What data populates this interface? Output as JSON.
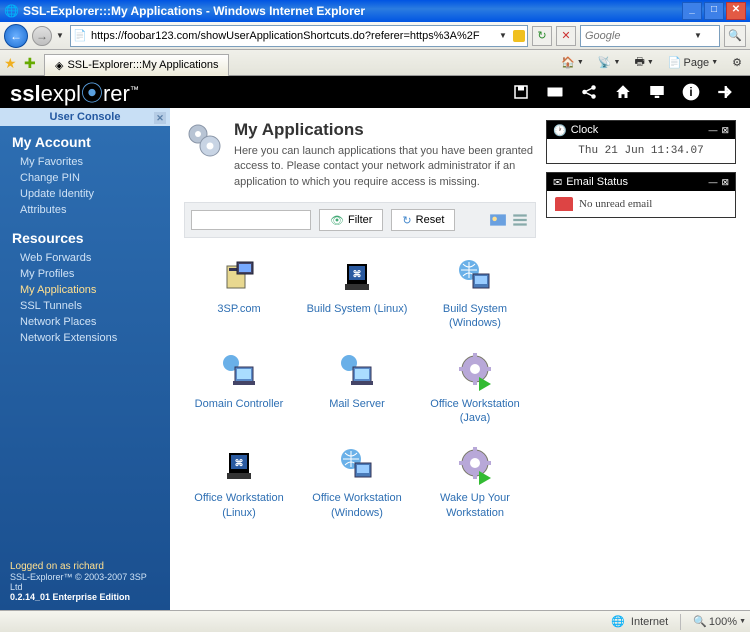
{
  "window": {
    "title": "SSL-Explorer:::My Applications - Windows Internet Explorer"
  },
  "browser": {
    "url": "https://foobar123.com/showUserApplicationShortcuts.do?referer=https%3A%2F",
    "search_placeholder": "Google",
    "tab_title": "SSL-Explorer:::My Applications",
    "cmd": {
      "page": "Page"
    },
    "status": {
      "zone": "Internet",
      "zoom": "100%"
    }
  },
  "logo": {
    "pre": "ssl",
    "mid": "expl",
    "o": "o",
    "post": "rer"
  },
  "sidebar": {
    "console_label": "User Console",
    "account_heading": "My Account",
    "account_links": [
      "My Favorites",
      "Change PIN",
      "Update Identity",
      "Attributes"
    ],
    "resources_heading": "Resources",
    "resource_links": [
      "Web Forwards",
      "My Profiles",
      "My Applications",
      "SSL Tunnels",
      "Network Places",
      "Network Extensions"
    ],
    "active_resource_index": 2,
    "logged_on": "Logged on as richard",
    "copyright": "SSL-Explorer™ © 2003-2007 3SP Ltd",
    "version": "0.2.14_01 Enterprise Edition"
  },
  "page": {
    "title": "My Applications",
    "description": "Here you can launch applications that you have been granted access to. Please contact your network administrator if an application to which you require access is missing.",
    "filter_label": "Filter",
    "reset_label": "Reset"
  },
  "apps": [
    {
      "label": "3SP.com",
      "icon": "server"
    },
    {
      "label": "Build System (Linux)",
      "icon": "linux"
    },
    {
      "label": "Build System (Windows)",
      "icon": "windows-globe"
    },
    {
      "label": "Domain Controller",
      "icon": "server-globe"
    },
    {
      "label": "Mail Server",
      "icon": "server-globe"
    },
    {
      "label": "Office Workstation (Java)",
      "icon": "gear-play"
    },
    {
      "label": "Office Workstation (Linux)",
      "icon": "linux"
    },
    {
      "label": "Office Workstation (Windows)",
      "icon": "windows-globe"
    },
    {
      "label": "Wake Up Your Workstation",
      "icon": "gear-play"
    }
  ],
  "panels": {
    "clock": {
      "title": "Clock",
      "value": "Thu 21 Jun 11:34.07"
    },
    "email": {
      "title": "Email Status",
      "message": "No unread email"
    }
  }
}
